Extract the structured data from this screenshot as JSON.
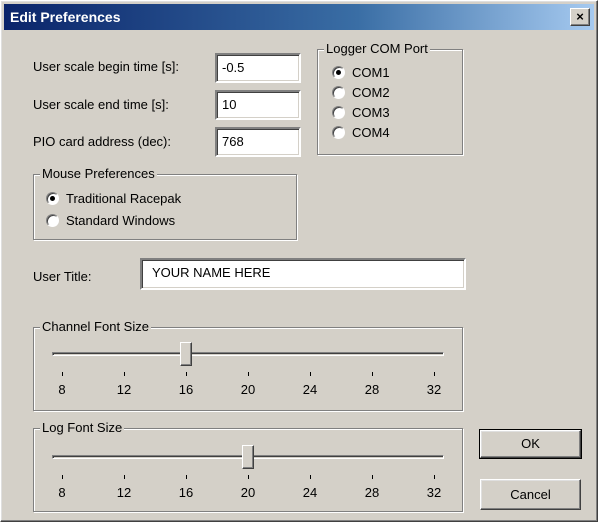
{
  "window": {
    "title": "Edit Preferences",
    "close_glyph": "×"
  },
  "fields": {
    "begin_label": "User scale begin time [s]:",
    "begin_value": "-0.5",
    "end_label": "User scale end time [s]:",
    "end_value": "10",
    "pio_label": "PIO card address (dec):",
    "pio_value": "768"
  },
  "logger": {
    "title": "Logger COM Port",
    "options": [
      {
        "label": "COM1",
        "checked": true
      },
      {
        "label": "COM2",
        "checked": false
      },
      {
        "label": "COM3",
        "checked": false
      },
      {
        "label": "COM4",
        "checked": false
      }
    ]
  },
  "mouse": {
    "title": "Mouse Preferences",
    "options": [
      {
        "label": "Traditional Racepak",
        "checked": true
      },
      {
        "label": "Standard Windows",
        "checked": false
      }
    ]
  },
  "user_title": {
    "label": "User Title:",
    "value": "YOUR NAME HERE"
  },
  "channel_font": {
    "title": "Channel Font Size",
    "ticks": [
      "8",
      "12",
      "16",
      "20",
      "24",
      "28",
      "32"
    ],
    "value": 16
  },
  "log_font": {
    "title": "Log Font Size",
    "ticks": [
      "8",
      "12",
      "16",
      "20",
      "24",
      "28",
      "32"
    ],
    "value": 20
  },
  "buttons": {
    "ok": "OK",
    "cancel": "Cancel"
  }
}
